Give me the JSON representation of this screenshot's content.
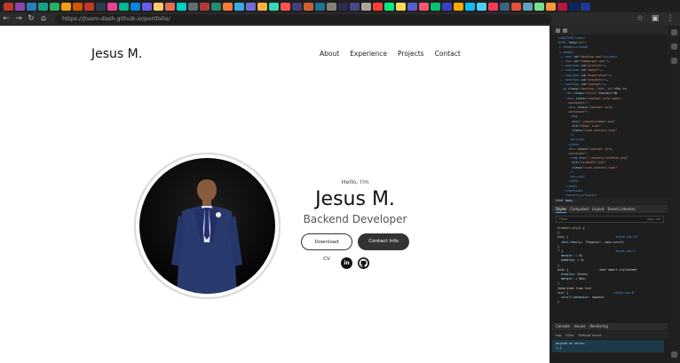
{
  "browser": {
    "url": "https://jtsem-dash.github.io/portfolio/",
    "tab_colors": [
      "#c0392b",
      "#8e44ad",
      "#2980b9",
      "#16a085",
      "#27ae60",
      "#f39c12",
      "#d35400",
      "#c0392b",
      "#2c3e50",
      "#e84393",
      "#00b894",
      "#0984e3",
      "#6c5ce7",
      "#fdcb6e",
      "#e17055",
      "#00cec9",
      "#636e72",
      "#b33939",
      "#218c74",
      "#ff793f",
      "#34ace0",
      "#706fd3",
      "#ffb142",
      "#33d9b2",
      "#ff5252",
      "#40407a",
      "#cd6133",
      "#227093",
      "#84817a",
      "#2c2c54",
      "#474787",
      "#aaa69d",
      "#ff3f34",
      "#0be881",
      "#ffdd59",
      "#575fcf",
      "#ef5777",
      "#05c46b",
      "#3c40c6",
      "#ffa801",
      "#0fbcf9",
      "#4bcffa",
      "#f53b57",
      "#3c6382",
      "#e55039",
      "#60a3bc",
      "#78e08f",
      "#fa983a",
      "#b71540",
      "#0c2461",
      "#1e3799"
    ]
  },
  "site": {
    "logo": "Jesus M.",
    "nav": [
      "About",
      "Experience",
      "Projects",
      "Contact"
    ],
    "greeting": "Hello, I'm",
    "name": "Jesus M.",
    "role": "Backend Developer",
    "download_cv": "Download CV",
    "contact_info": "Contact Info",
    "linkedin_label": "in"
  },
  "devtools": {
    "breadcrumb": "html  body",
    "tabs": [
      "Styles",
      "Computed",
      "Layout",
      "Event Listeners"
    ],
    "filter_placeholder": "Filter",
    "filter_right": ":hov .cls",
    "console_tabs": [
      "Console",
      "Issues",
      "Rendering"
    ],
    "console_tools": [
      "top",
      "Filter",
      "Default levels"
    ],
    "console_line1": "asynch at error.  ",
    "console_line2": "(…)"
  },
  "colors": {
    "dark": "#333333",
    "page_bg": "#ffffff",
    "devtools_bg": "#1e1e1e"
  }
}
